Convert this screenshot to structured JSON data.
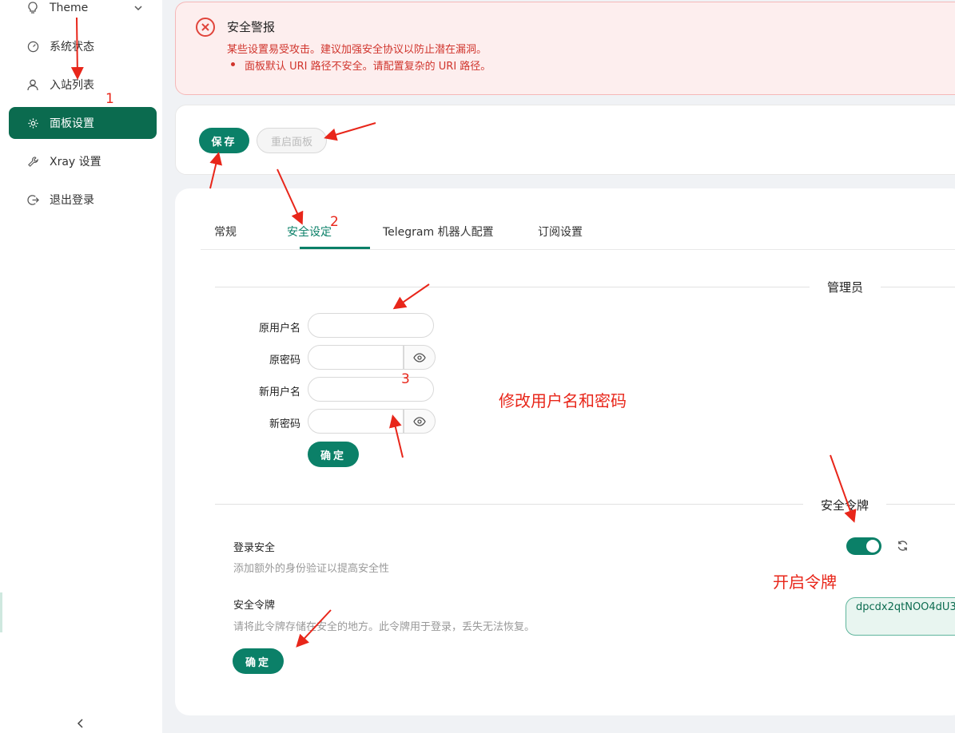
{
  "sidebar": {
    "items": [
      {
        "label": "Theme",
        "icon": "bulb-icon"
      },
      {
        "label": "系统状态",
        "icon": "dashboard-icon"
      },
      {
        "label": "入站列表",
        "icon": "user-icon"
      },
      {
        "label": "面板设置",
        "icon": "gear-icon",
        "active": true
      },
      {
        "label": "Xray 设置",
        "icon": "wrench-icon"
      },
      {
        "label": "退出登录",
        "icon": "logout-icon"
      }
    ]
  },
  "alert": {
    "title": "安全警报",
    "description": "某些设置易受攻击。建议加强安全协议以防止潜在漏洞。",
    "items": [
      "面板默认 URI 路径不安全。请配置复杂的 URI 路径。"
    ]
  },
  "toolbar": {
    "save_label": "保存",
    "restart_label": "重启面板"
  },
  "tabs": [
    {
      "label": "常规"
    },
    {
      "label": "安全设定",
      "active": true
    },
    {
      "label": "Telegram 机器人配置"
    },
    {
      "label": "订阅设置"
    }
  ],
  "admin_section": {
    "title": "管理员",
    "fields": {
      "old_username": "原用户名",
      "old_password": "原密码",
      "new_username": "新用户名",
      "new_password": "新密码"
    },
    "confirm_label": "确定"
  },
  "token_section": {
    "title": "安全令牌",
    "login_security_title": "登录安全",
    "login_security_desc": "添加额外的身份验证以提高安全性",
    "token_title": "安全令牌",
    "token_desc": "请将此令牌存储在安全的地方。此令牌用于登录，丢失无法恢复。",
    "token_value": "dpcdx2qtNOO4dU3",
    "switch_on": true,
    "confirm_label": "确定"
  },
  "annotations": {
    "n1": "1",
    "n2": "2",
    "n3": "3",
    "modify_note": "修改用户名和密码",
    "token_note": "开启令牌"
  },
  "colors": {
    "primary": "#0b8068",
    "sidebar_active": "#0b6b4f",
    "alert_bg": "#fdeeee",
    "alert_text": "#d0342c",
    "annotation": "#e8261a"
  }
}
